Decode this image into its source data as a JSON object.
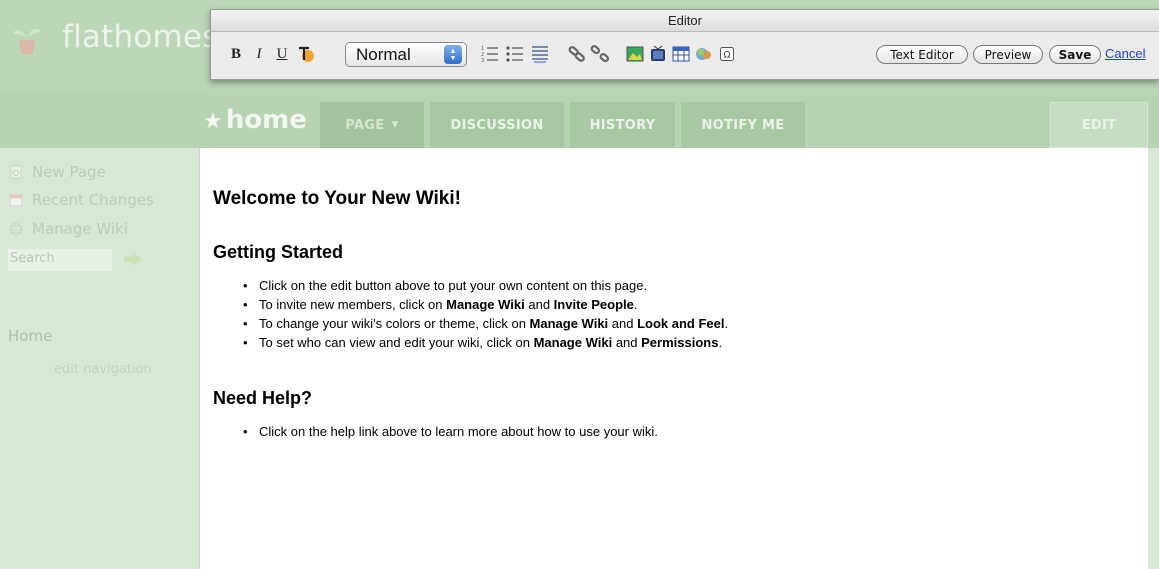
{
  "site": {
    "title": "flathomesc",
    "page_name": "home",
    "page_star": "★",
    "tabs": {
      "page": "PAGE",
      "page_caret": "▼",
      "discussion": "DISCUSSION",
      "history": "HISTORY",
      "notify": "NOTIFY ME",
      "edit": "EDIT"
    }
  },
  "sidebar": {
    "new_page": "New Page",
    "recent_changes": "Recent Changes",
    "manage_wiki": "Manage Wiki",
    "search_placeholder": "Search",
    "nav_home": "Home",
    "edit_navigation": "edit navigation"
  },
  "editor": {
    "title": "Editor",
    "bold": "B",
    "italic": "I",
    "underline": "U",
    "style_value": "Normal",
    "buttons": {
      "text_editor": "Text Editor",
      "preview": "Preview",
      "save": "Save",
      "cancel": "Cancel"
    },
    "icons": [
      "text-color-icon",
      "ordered-list-icon",
      "unordered-list-icon",
      "indent-icon",
      "link-icon",
      "unlink-icon",
      "image-icon",
      "media-icon",
      "table-icon",
      "widget-icon",
      "special-char-icon"
    ]
  },
  "content": {
    "welcome": "Welcome to Your New Wiki!",
    "getting_started": {
      "heading": "Getting Started",
      "items": [
        {
          "parts": [
            "Click on the edit button above to put your own content on this page."
          ]
        },
        {
          "parts": [
            "To invite new members, click on ",
            "Manage Wiki",
            " and ",
            "Invite People",
            "."
          ]
        },
        {
          "parts": [
            "To change your wiki's colors or theme, click on ",
            "Manage Wiki",
            " and ",
            "Look and Feel",
            "."
          ]
        },
        {
          "parts": [
            "To set who can view and edit your wiki, click on ",
            "Manage Wiki",
            " and ",
            "Permissions",
            "."
          ]
        }
      ]
    },
    "need_help": {
      "heading": "Need Help?",
      "items": [
        {
          "parts": [
            "Click on the help link above to learn more about how to use your wiki."
          ]
        }
      ]
    }
  },
  "colors": {
    "header_bg": "#bcd6b8",
    "tab_bg": "#a8c7a3",
    "sidebar_bg": "#d9e7d6",
    "cancel_link": "#1f3fd0",
    "stepper_blue": "#2f6fcf"
  }
}
